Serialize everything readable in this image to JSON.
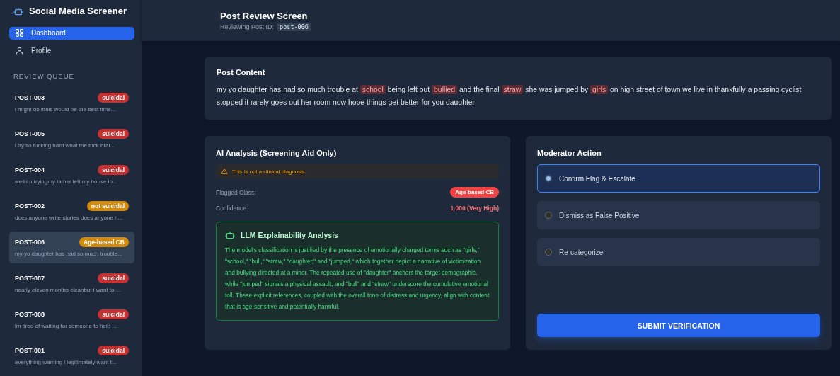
{
  "sidebar": {
    "app_title": "Social Media Screener",
    "nav": [
      {
        "label": "Dashboard",
        "selected": true
      },
      {
        "label": "Profile",
        "selected": false
      }
    ],
    "queue_heading": "REVIEW QUEUE",
    "queue": [
      {
        "id": "POST-003",
        "tag": "suicidal",
        "color": "#c53030",
        "preview": "i might do itthis would be the best time...",
        "selected": false
      },
      {
        "id": "POST-005",
        "tag": "suicidal",
        "color": "#c53030",
        "preview": "i try so fucking hard what the fuck brai...",
        "selected": false
      },
      {
        "id": "POST-004",
        "tag": "suicidal",
        "color": "#c53030",
        "preview": "well im tryingmy father left my house lo...",
        "selected": false
      },
      {
        "id": "POST-002",
        "tag": "not suicidal",
        "color": "#d48a0c",
        "preview": "does anyone write stories does anyone h...",
        "selected": false
      },
      {
        "id": "POST-006",
        "tag": "Age-based CB",
        "color": "#d48a0c",
        "preview": "my yo daughter has had so much trouble...",
        "selected": true
      },
      {
        "id": "POST-007",
        "tag": "suicidal",
        "color": "#c53030",
        "preview": "nearly eleven months cleanbut i want to ...",
        "selected": false
      },
      {
        "id": "POST-008",
        "tag": "suicidal",
        "color": "#c53030",
        "preview": "im tired of waiting for someone to help ...",
        "selected": false
      },
      {
        "id": "POST-001",
        "tag": "suicidal",
        "color": "#c53030",
        "preview": "everything warning i legitimately want t...",
        "selected": false
      }
    ]
  },
  "header": {
    "title": "Post Review Screen",
    "subtitle": "Reviewing Post ID:",
    "post_id": "post-006"
  },
  "post_content": {
    "title": "Post Content",
    "segments": [
      {
        "text": "my yo daughter has had so much trouble at",
        "highlighted": false
      },
      {
        "text": "school",
        "highlighted": true
      },
      {
        "text": "being left out",
        "highlighted": false
      },
      {
        "text": "bullied",
        "highlighted": true
      },
      {
        "text": "and the final",
        "highlighted": false
      },
      {
        "text": "straw",
        "highlighted": true
      },
      {
        "text": "she was jumped by",
        "highlighted": false
      },
      {
        "text": "girls",
        "highlighted": true
      },
      {
        "text": "on high street of town we live in thankfully a passing cyclist stopped it rarely goes out her room now hope things get better for you daughter",
        "highlighted": false
      }
    ]
  },
  "ai_analysis": {
    "title": "AI Analysis (Screening Aid Only)",
    "warning": "This is not a clinical diagnosis.",
    "flagged_label": "Flagged Class:",
    "flagged_value": "Age-based CB",
    "confidence_label": "Confidence:",
    "confidence_value": "1.000 (Very High)",
    "llm_title": "LLM Explainability Analysis",
    "llm_text": "The model's classification is justified by the presence of emotionally charged terms such as \"girls,\" \"school,\" \"bull,\" \"straw,\" \"daughter,\" and \"jumped,\" which together depict a narrative of victimization and bullying directed at a minor. The repeated use of \"daughter\" anchors the target demographic, while \"jumped\" signals a physical assault, and \"bull\" and \"straw\" underscore the cumulative emotional toll. These explicit references, coupled with the overall tone of distress and urgency, align with content that is age-sensitive and potentially harmful."
  },
  "moderator_action": {
    "title": "Moderator Action",
    "options": [
      {
        "label": "Confirm Flag & Escalate",
        "selected": true
      },
      {
        "label": "Dismiss as False Positive",
        "selected": false
      },
      {
        "label": "Re-categorize",
        "selected": false
      }
    ],
    "submit": "SUBMIT VERIFICATION"
  }
}
